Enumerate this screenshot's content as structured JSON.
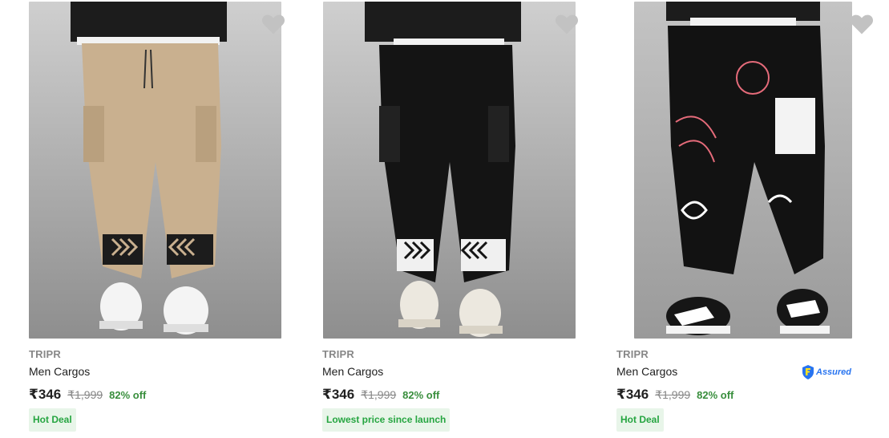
{
  "colors": {
    "price_text": "#212121",
    "brand_text": "#878787",
    "discount_green": "#388e3c",
    "deal_bg": "#e8f5e9",
    "deal_text": "#26a541",
    "assured_blue": "#2874f0",
    "wishlist_gray": "#c2c2c2"
  },
  "products": [
    {
      "brand": "TRIPR",
      "title": "Men Cargos",
      "price": "₹346",
      "mrp": "₹1,999",
      "discount": "82% off",
      "deal_tag": "Hot Deal",
      "assured": false,
      "image_icon": "beige-cargo-pants-photo",
      "wishlist_icon": "heart-icon"
    },
    {
      "brand": "TRIPR",
      "title": "Men Cargos",
      "price": "₹346",
      "mrp": "₹1,999",
      "discount": "82% off",
      "deal_tag": "Lowest price since launch",
      "assured": false,
      "image_icon": "black-cargo-pants-photo",
      "wishlist_icon": "heart-icon"
    },
    {
      "brand": "TRIPR",
      "title": "Men Cargos",
      "price": "₹346",
      "mrp": "₹1,999",
      "discount": "82% off",
      "deal_tag": "Hot Deal",
      "assured": true,
      "assured_label": "Assured",
      "image_icon": "graphic-print-cargo-pants-photo",
      "wishlist_icon": "heart-icon"
    }
  ]
}
